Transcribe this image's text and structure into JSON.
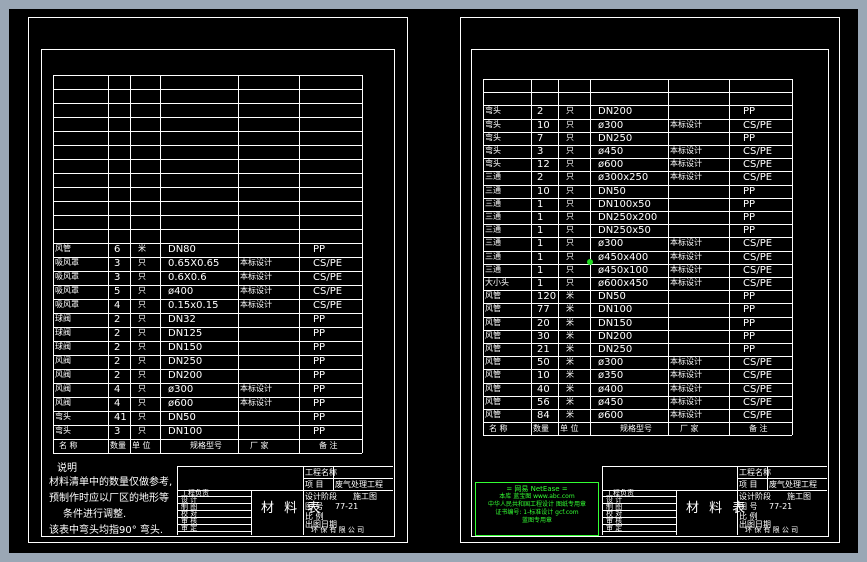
{
  "left_sheet": {
    "rows": [
      {
        "name": "风管",
        "qty": "6",
        "unit": "米",
        "spec": "DN80",
        "note": "",
        "mat": "PP"
      },
      {
        "name": "吸风罩",
        "qty": "3",
        "unit": "只",
        "spec": "0.65X0.65",
        "note": "本标设计",
        "mat": "CS/PE"
      },
      {
        "name": "吸风罩",
        "qty": "3",
        "unit": "只",
        "spec": "0.6X0.6",
        "note": "本标设计",
        "mat": "CS/PE"
      },
      {
        "name": "吸风罩",
        "qty": "5",
        "unit": "只",
        "spec": "ø400",
        "note": "本标设计",
        "mat": "CS/PE"
      },
      {
        "name": "吸风罩",
        "qty": "4",
        "unit": "只",
        "spec": "0.15x0.15",
        "note": "本标设计",
        "mat": "CS/PE"
      },
      {
        "name": "球阀",
        "qty": "2",
        "unit": "只",
        "spec": "DN32",
        "note": "",
        "mat": "PP"
      },
      {
        "name": "球阀",
        "qty": "2",
        "unit": "只",
        "spec": "DN125",
        "note": "",
        "mat": "PP"
      },
      {
        "name": "球阀",
        "qty": "2",
        "unit": "只",
        "spec": "DN150",
        "note": "",
        "mat": "PP"
      },
      {
        "name": "风阀",
        "qty": "2",
        "unit": "只",
        "spec": "DN250",
        "note": "",
        "mat": "PP"
      },
      {
        "name": "风阀",
        "qty": "2",
        "unit": "只",
        "spec": "DN200",
        "note": "",
        "mat": "PP"
      },
      {
        "name": "风阀",
        "qty": "4",
        "unit": "只",
        "spec": "ø300",
        "note": "本标设计",
        "mat": "PP"
      },
      {
        "name": "风阀",
        "qty": "4",
        "unit": "只",
        "spec": "ø600",
        "note": "本标设计",
        "mat": "PP"
      },
      {
        "name": "弯头",
        "qty": "41",
        "unit": "只",
        "spec": "DN50",
        "note": "",
        "mat": "PP"
      },
      {
        "name": "弯头",
        "qty": "3",
        "unit": "只",
        "spec": "DN100",
        "note": "",
        "mat": "PP"
      }
    ],
    "notes": [
      "说明",
      "材料清单中的数量仅做参考,",
      "预制作时应以厂区的地形等",
      "条件进行调整.",
      "该表中弯头均指90° 弯头."
    ]
  },
  "right_sheet": {
    "rows": [
      {
        "name": "弯头",
        "qty": "2",
        "unit": "只",
        "spec": "DN200",
        "note": "",
        "mat": "PP"
      },
      {
        "name": "弯头",
        "qty": "10",
        "unit": "只",
        "spec": "ø300",
        "note": "本标设计",
        "mat": "CS/PE"
      },
      {
        "name": "弯头",
        "qty": "7",
        "unit": "只",
        "spec": "DN250",
        "note": "",
        "mat": "PP"
      },
      {
        "name": "弯头",
        "qty": "3",
        "unit": "只",
        "spec": "ø450",
        "note": "本标设计",
        "mat": "CS/PE"
      },
      {
        "name": "弯头",
        "qty": "12",
        "unit": "只",
        "spec": "ø600",
        "note": "本标设计",
        "mat": "CS/PE"
      },
      {
        "name": "三通",
        "qty": "2",
        "unit": "只",
        "spec": "ø300x250",
        "note": "本标设计",
        "mat": "CS/PE"
      },
      {
        "name": "三通",
        "qty": "10",
        "unit": "只",
        "spec": "DN50",
        "note": "",
        "mat": "PP"
      },
      {
        "name": "三通",
        "qty": "1",
        "unit": "只",
        "spec": "DN100x50",
        "note": "",
        "mat": "PP"
      },
      {
        "name": "三通",
        "qty": "1",
        "unit": "只",
        "spec": "DN250x200",
        "note": "",
        "mat": "PP"
      },
      {
        "name": "三通",
        "qty": "1",
        "unit": "只",
        "spec": "DN250x50",
        "note": "",
        "mat": "PP"
      },
      {
        "name": "三通",
        "qty": "1",
        "unit": "只",
        "spec": "ø300",
        "note": "本标设计",
        "mat": "CS/PE"
      },
      {
        "name": "三通",
        "qty": "1",
        "unit": "只",
        "spec": "ø450x400",
        "note": "本标设计",
        "mat": "CS/PE"
      },
      {
        "name": "三通",
        "qty": "1",
        "unit": "只",
        "spec": "ø450x100",
        "note": "本标设计",
        "mat": "CS/PE"
      },
      {
        "name": "大小头",
        "qty": "1",
        "unit": "只",
        "spec": "ø600x450",
        "note": "本标设计",
        "mat": "CS/PE"
      },
      {
        "name": "风管",
        "qty": "120",
        "unit": "米",
        "spec": "DN50",
        "note": "",
        "mat": "PP"
      },
      {
        "name": "风管",
        "qty": "77",
        "unit": "米",
        "spec": "DN100",
        "note": "",
        "mat": "PP"
      },
      {
        "name": "风管",
        "qty": "20",
        "unit": "米",
        "spec": "DN150",
        "note": "",
        "mat": "PP"
      },
      {
        "name": "风管",
        "qty": "30",
        "unit": "米",
        "spec": "DN200",
        "note": "",
        "mat": "PP"
      },
      {
        "name": "风管",
        "qty": "21",
        "unit": "米",
        "spec": "DN250",
        "note": "",
        "mat": "PP"
      },
      {
        "name": "风管",
        "qty": "50",
        "unit": "米",
        "spec": "ø300",
        "note": "本标设计",
        "mat": "CS/PE"
      },
      {
        "name": "风管",
        "qty": "10",
        "unit": "米",
        "spec": "ø350",
        "note": "本标设计",
        "mat": "CS/PE"
      },
      {
        "name": "风管",
        "qty": "40",
        "unit": "米",
        "spec": "ø400",
        "note": "本标设计",
        "mat": "CS/PE"
      },
      {
        "name": "风管",
        "qty": "56",
        "unit": "米",
        "spec": "ø450",
        "note": "本标设计",
        "mat": "CS/PE"
      },
      {
        "name": "风管",
        "qty": "84",
        "unit": "米",
        "spec": "ø600",
        "note": "本标设计",
        "mat": "CS/PE"
      }
    ],
    "stamp": [
      "= 网易 NetEase =",
      "本库 蓝宝图 www.abc.com",
      "中华人民共和国工程设计 图纸专用章",
      "证书编号: 1-标准设计 gcf.com",
      "蓝图专用章"
    ]
  },
  "header": {
    "name": "名 称",
    "qty": "数量",
    "unit": "单 位",
    "spec": "规格型号",
    "maker": "厂 家",
    "remark": "备 注"
  },
  "title_block": {
    "project_name_label": "工程名称",
    "project_label": "项 目",
    "project_value": "废气处理工程",
    "roles": [
      "工程负责",
      "设 计",
      "制 图",
      "校 对",
      "审 核",
      "审 定"
    ],
    "table_title": "材 料 表",
    "stage_label": "设计阶段",
    "stage_value": "施工图",
    "drawing_no_label": "图 号",
    "drawing_no_value": "77-21",
    "scale_label": "比 例",
    "date_label": "出图日期",
    "company": "环 保 有 限 公 司"
  },
  "colors": {
    "frame": "#9aa7b5",
    "background": "#000000",
    "lines": "#ffffff",
    "stamp": "#33ff33"
  }
}
